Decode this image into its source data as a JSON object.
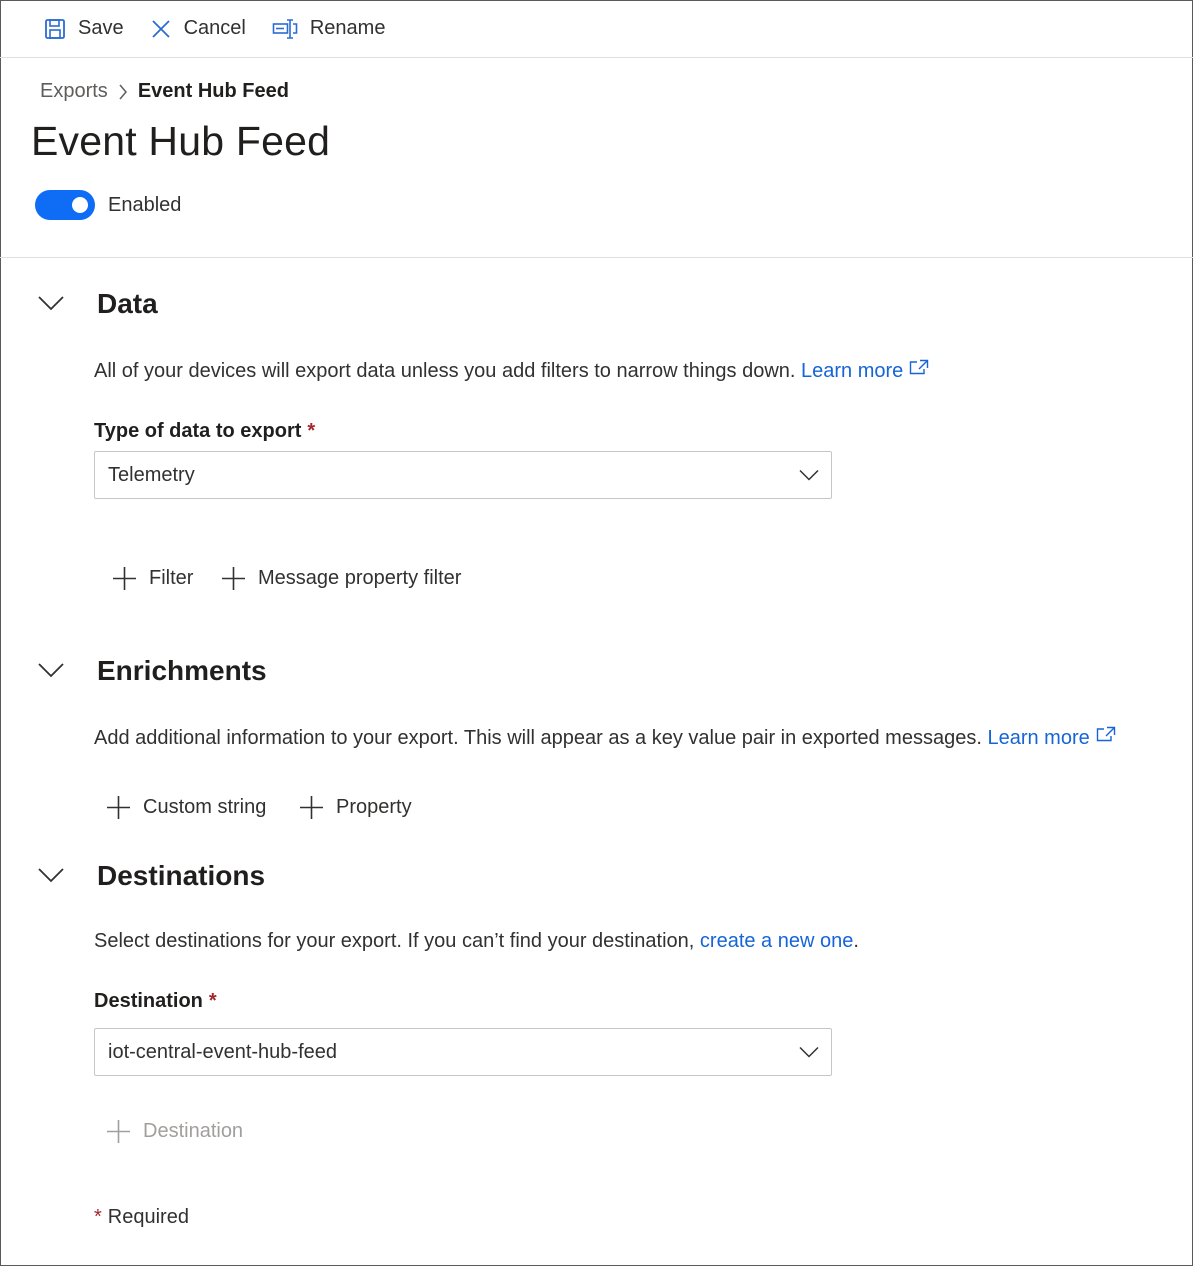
{
  "toolbar": {
    "save_label": "Save",
    "cancel_label": "Cancel",
    "rename_label": "Rename"
  },
  "breadcrumb": {
    "parent": "Exports",
    "current": "Event Hub Feed"
  },
  "page": {
    "title": "Event Hub Feed",
    "toggle_label": "Enabled",
    "toggle_on": true
  },
  "data_section": {
    "title": "Data",
    "description": "All of your devices will export data unless you add filters to narrow things down.",
    "learn_more": "Learn more",
    "type_label": "Type of data to export",
    "type_value": "Telemetry",
    "filter_label": "Filter",
    "message_filter_label": "Message property filter"
  },
  "enrichments_section": {
    "title": "Enrichments",
    "description": "Add additional information to your export. This will appear as a key value pair in exported messages.",
    "learn_more": "Learn more",
    "custom_string_label": "Custom string",
    "property_label": "Property"
  },
  "destinations_section": {
    "title": "Destinations",
    "description": "Select destinations for your export. If you can’t find your destination,",
    "create_link": "create a new one",
    "period": ".",
    "destination_label": "Destination",
    "destination_value": "iot-central-event-hub-feed",
    "add_destination_label": "Destination"
  },
  "required": {
    "asterisk": "*",
    "note": "Required"
  },
  "colors": {
    "accent": "#0f6cf5",
    "link": "#1565d8",
    "required": "#a4262c",
    "toolbar_icon": "#2b6cd4",
    "disabled": "#a19f9d"
  }
}
